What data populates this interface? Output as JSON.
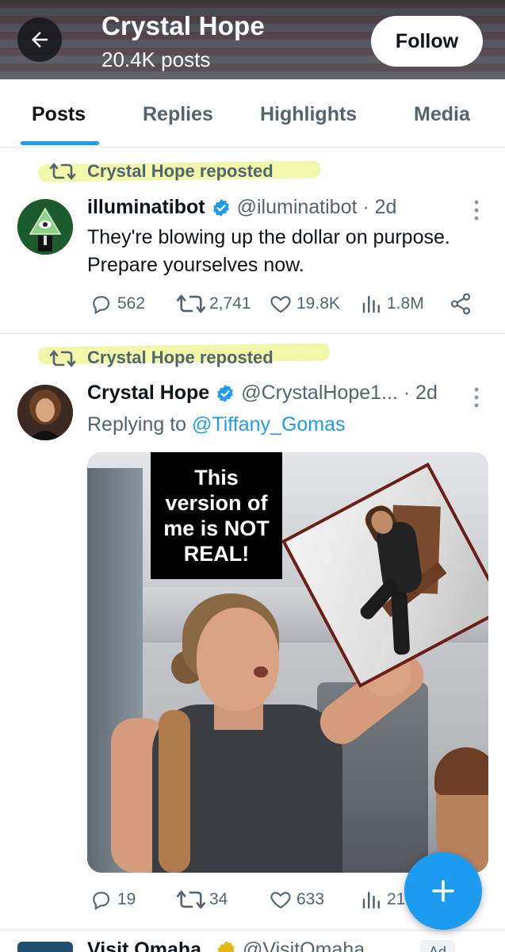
{
  "header": {
    "name": "Crystal Hope",
    "posts_count": "20.4K posts",
    "follow_label": "Follow"
  },
  "tabs": [
    {
      "label": "Posts",
      "active": true
    },
    {
      "label": "Replies",
      "active": false
    },
    {
      "label": "Highlights",
      "active": false
    },
    {
      "label": "Media",
      "active": false
    }
  ],
  "posts": [
    {
      "repost_label": "Crystal Hope reposted",
      "author": "illuminatibot",
      "handle_time": "@iluminatibot · 2d",
      "text": "They're blowing up the dollar on purpose. Prepare yourselves now.",
      "replies": "562",
      "reposts": "2,741",
      "likes": "19.8K",
      "views": "1.8M"
    },
    {
      "repost_label": "Crystal Hope reposted",
      "author": "Crystal Hope",
      "handle_time": "@CrystalHope1... · 2d",
      "replying_prefix": "Replying to",
      "replying_to": "@Tiffany_Gomas",
      "media_caption": "This version of me is NOT REAL!",
      "replies": "19",
      "reposts": "34",
      "likes": "633",
      "views": "21"
    }
  ],
  "next_post": {
    "author": "Visit Omaha",
    "handle": "@VisitOmaha",
    "ad_label": "Ad"
  },
  "colors": {
    "accent": "#1d9bf0",
    "secondary_text": "#536471",
    "highlight": "#f0f79b"
  }
}
